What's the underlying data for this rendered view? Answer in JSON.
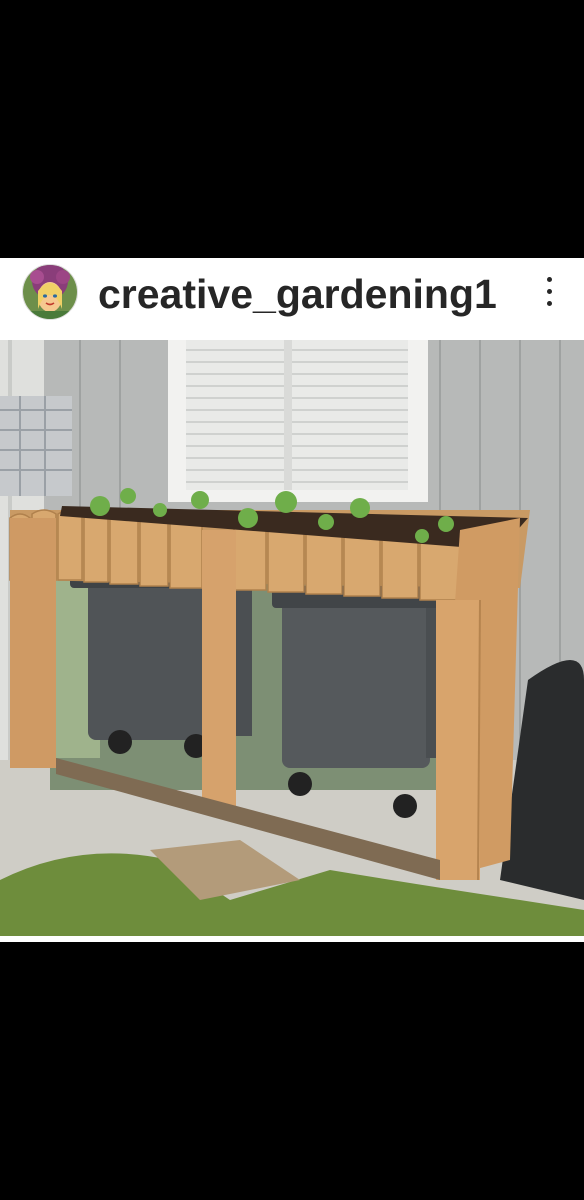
{
  "post": {
    "username": "creative_gardening1",
    "avatar": "profile-avatar",
    "menu_icon": "more-vertical-icon",
    "photo_subject": "photo"
  },
  "colors": {
    "background": "#000000",
    "card": "#ffffff",
    "username_text": "#262626"
  }
}
